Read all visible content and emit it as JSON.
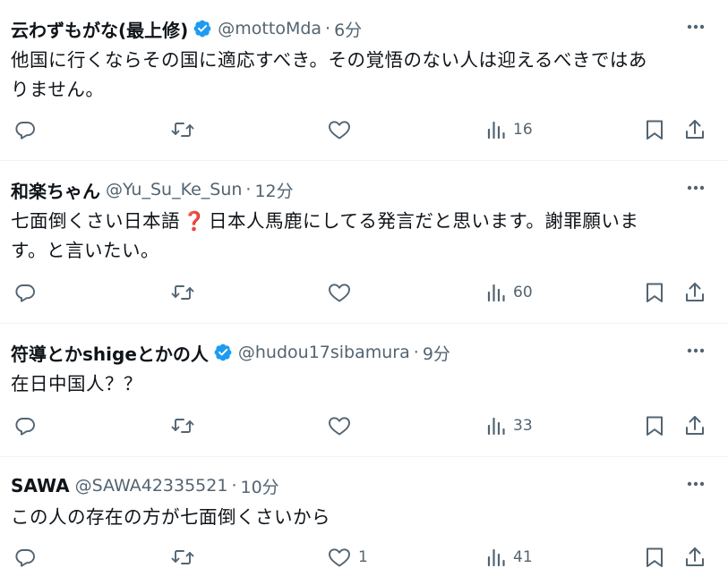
{
  "tweets": [
    {
      "display_name": "云わずもがな(最上修)",
      "verified": true,
      "handle": "@mottoMda",
      "separator": "·",
      "time": "6分",
      "text_parts": [
        "他国に行くならその国に適応すべき。その覚悟のない人は迎えるべきではあ",
        "りません。"
      ],
      "likes": "",
      "views": "16"
    },
    {
      "display_name": "和楽ちゃん",
      "verified": false,
      "handle": "@Yu_Su_Ke_Sun",
      "separator": "·",
      "time": "12分",
      "text_before_emoji": "七面倒くさい日本語",
      "emoji": "❓",
      "text_after_emoji": "日本人馬鹿にしてる発言だと思います。謝罪願いま",
      "text_line2": "す。と言いたい。",
      "likes": "",
      "views": "60"
    },
    {
      "display_name": "符導とかshigeとかの人",
      "verified": true,
      "handle": "@hudou17sibamura",
      "separator": "·",
      "time": "9分",
      "text": "在日中国人？？",
      "likes": "",
      "views": "33"
    },
    {
      "display_name": "SAWA",
      "verified": false,
      "handle": "@SAWA42335521",
      "separator": "·",
      "time": "10分",
      "text": "この人の存在の方が七面倒くさいから",
      "likes": "1",
      "views": "41"
    }
  ],
  "icons": {
    "reply": "reply-icon",
    "retweet": "retweet-icon",
    "like": "heart-icon",
    "views": "views-chart-icon",
    "bookmark": "bookmark-icon",
    "share": "share-icon",
    "more": "more-dots-icon",
    "verified": "verified-badge-icon"
  },
  "colors": {
    "text": "#0f1419",
    "secondary": "#536471",
    "verified": "#1d9bf0",
    "divider": "#eff3f4",
    "emoji": "#d2203a"
  }
}
